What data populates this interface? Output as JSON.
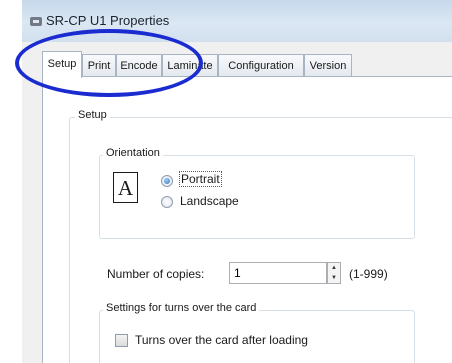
{
  "window": {
    "title": "SR-CP U1 Properties"
  },
  "tabs": [
    {
      "label": "Setup",
      "active": true
    },
    {
      "label": "Print",
      "active": false
    },
    {
      "label": "Encode",
      "active": false
    },
    {
      "label": "Laminate",
      "active": false
    },
    {
      "label": "Configuration",
      "active": false
    },
    {
      "label": "Version",
      "active": false
    }
  ],
  "setup": {
    "group_label": "Setup",
    "orientation": {
      "label": "Orientation",
      "icon": "portrait-page-icon",
      "icon_glyph": "A",
      "options": [
        {
          "label": "Portrait",
          "checked": true
        },
        {
          "label": "Landscape",
          "checked": false
        }
      ]
    },
    "copies": {
      "label": "Number of copies:",
      "value": "1",
      "range": "(1-999)"
    },
    "turnover": {
      "group_label": "Settings for turns over the card",
      "checkbox_label": "Turns over the card after loading",
      "checked": false
    }
  },
  "annotation": {
    "color": "#1a2bd0",
    "shape": "ellipse"
  },
  "colors": {
    "titlebar": "#d2e0ee",
    "dialog_bg": "#f0f0f0",
    "tab_page": "#ffffff",
    "border": "#a9b5c4"
  }
}
